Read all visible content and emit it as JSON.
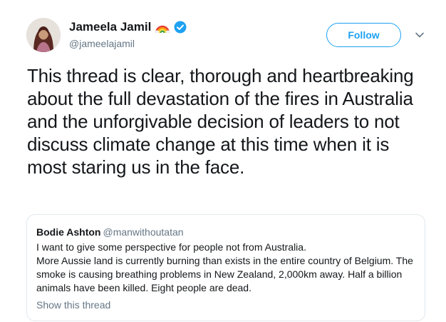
{
  "author": {
    "display_name": "Jameela Jamil",
    "emoji": "rainbow",
    "verified_icon": "verified-badge-icon",
    "handle": "@jameelajamil"
  },
  "follow_label": "Follow",
  "tweet_text": "This thread is clear, thorough and heartbreaking about the full devastation of the fires in Australia and the unforgivable decision of leaders to not discuss climate change at this time when it is most staring us in the face.",
  "quoted": {
    "name": "Bodie Ashton",
    "handle": "@manwithoutatan",
    "lines": [
      "I want to give some perspective for people not from Australia.",
      "More Aussie land is currently burning than exists in the entire country of Belgium. The smoke is causing breathing problems in New Zealand, 2,000km away. Half a billion animals have been killed. Eight people are dead."
    ],
    "show_thread": "Show this thread"
  },
  "colors": {
    "accent": "#1da1f2",
    "secondary_text": "#657786",
    "border": "#e1e8ed"
  }
}
